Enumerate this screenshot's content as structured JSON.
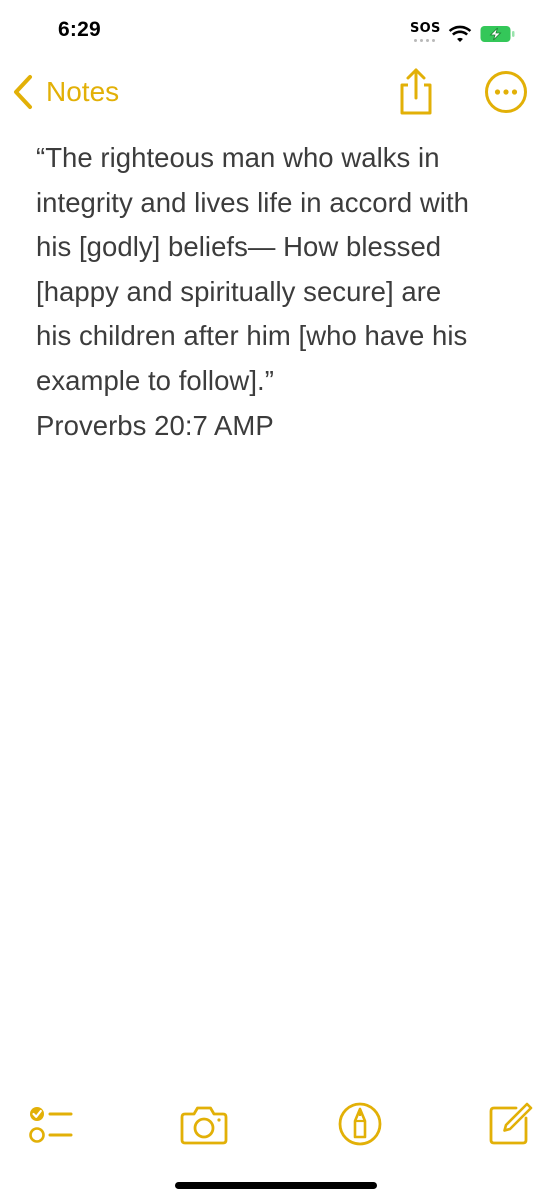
{
  "status_bar": {
    "time": "6:29",
    "carrier_text": "SOS",
    "wifi_icon": "wifi-icon",
    "battery_icon": "battery-charging-icon",
    "battery_color": "#34c759"
  },
  "nav": {
    "back_label": "Notes",
    "back_icon": "chevron-left-icon",
    "share_icon": "share-icon",
    "more_icon": "ellipsis-circle-icon",
    "accent_color": "#e2b007"
  },
  "note": {
    "lines": [
      "“The righteous man who walks in",
      "integrity and lives life in accord with",
      "his [godly] beliefs— How blessed",
      "[happy and spiritually secure] are",
      "his children after him [who have his",
      "example to follow].”",
      "Proverbs 20:7 AMP"
    ]
  },
  "toolbar": {
    "items": [
      {
        "name": "checklist",
        "icon": "checklist-icon"
      },
      {
        "name": "camera",
        "icon": "camera-icon"
      },
      {
        "name": "markup",
        "icon": "markup-pen-icon"
      },
      {
        "name": "compose",
        "icon": "compose-icon"
      }
    ]
  }
}
